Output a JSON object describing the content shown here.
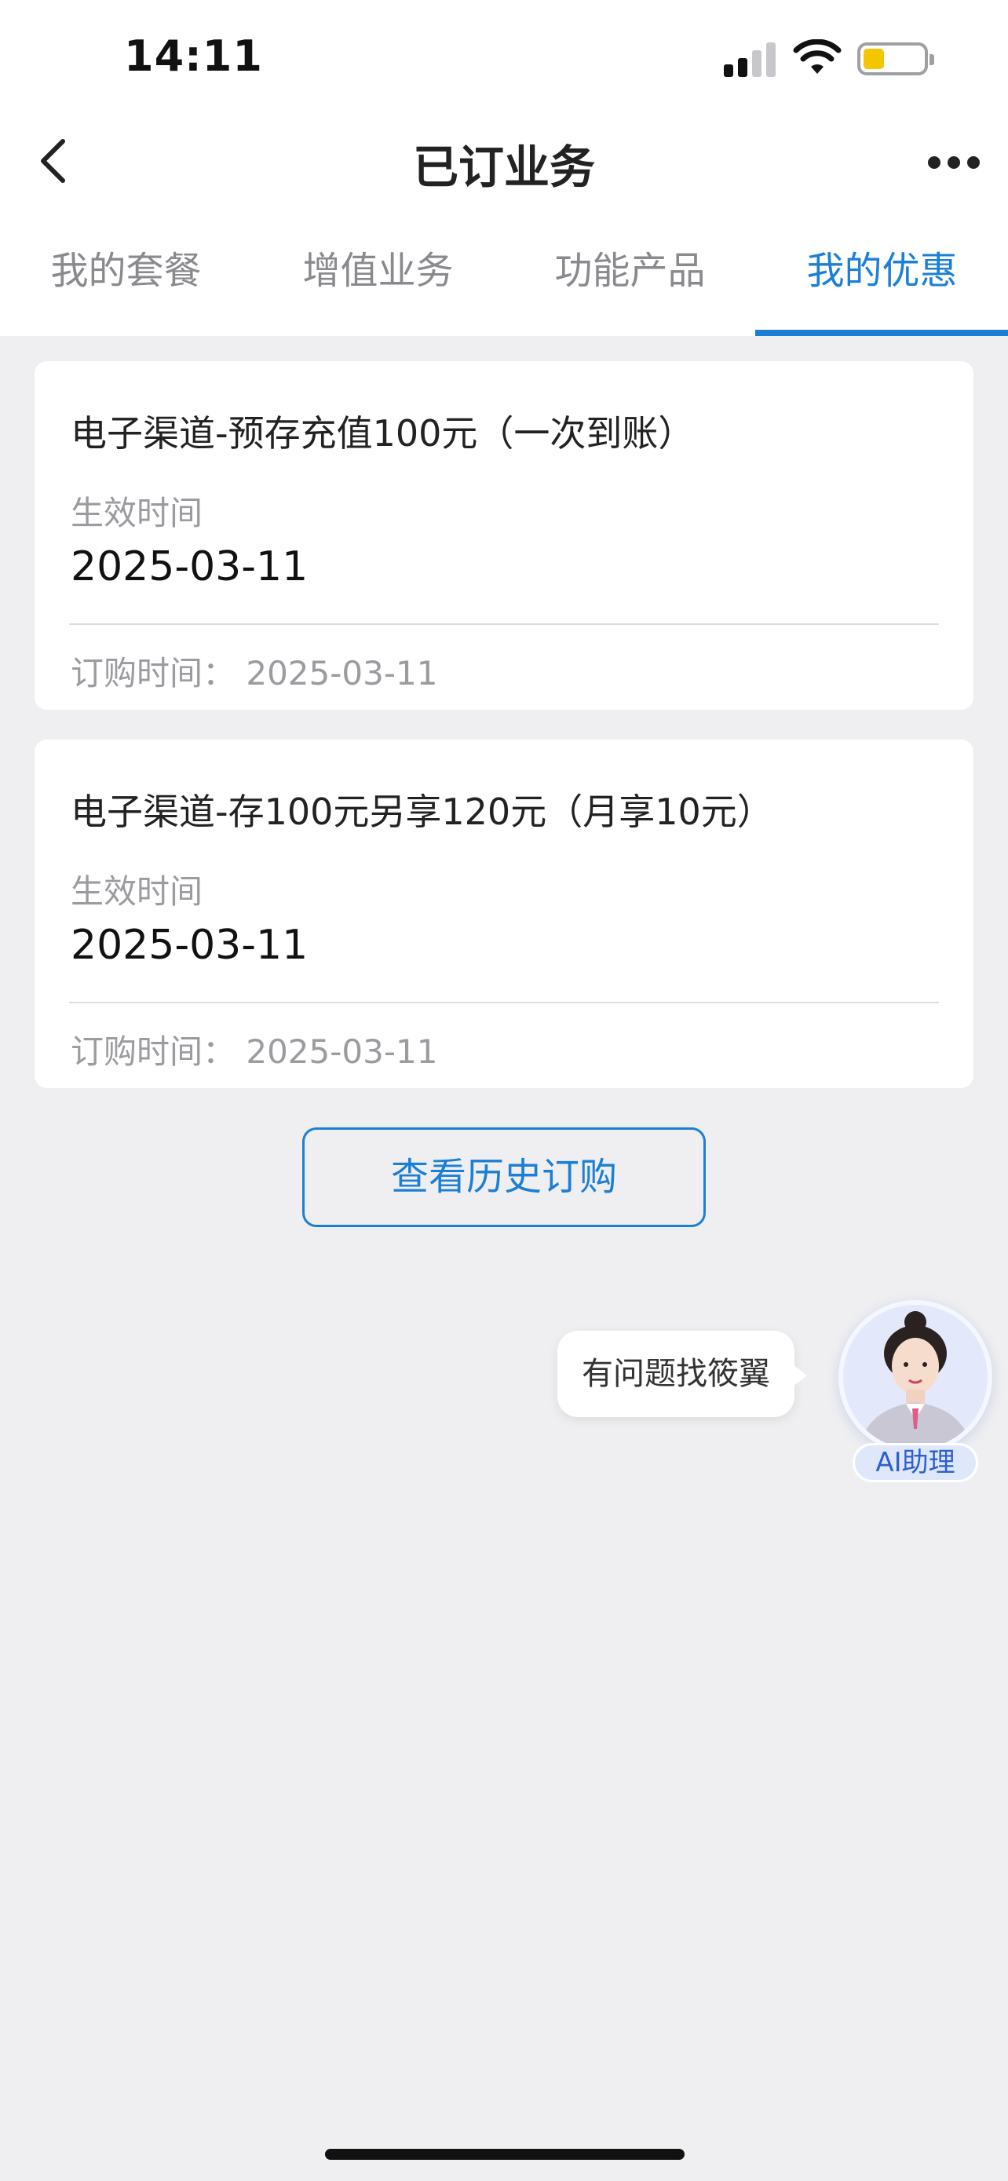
{
  "status_bar": {
    "time": "14:11"
  },
  "nav": {
    "title": "已订业务",
    "back_icon": "chevron-left-icon",
    "more_icon": "more-dots-icon"
  },
  "tabs": [
    {
      "label": "我的套餐",
      "active": false
    },
    {
      "label": "增值业务",
      "active": false
    },
    {
      "label": "功能产品",
      "active": false
    },
    {
      "label": "我的优惠",
      "active": true
    }
  ],
  "cards": [
    {
      "title": "电子渠道-预存充值100元（一次到账）",
      "effective_label": "生效时间",
      "effective_date": "2025-03-11",
      "order_text": "订购时间：  2025-03-11"
    },
    {
      "title": "电子渠道-存100元另享120元（月享10元）",
      "effective_label": "生效时间",
      "effective_date": "2025-03-11",
      "order_text": "订购时间：  2025-03-11"
    }
  ],
  "history_button": "查看历史订购",
  "assistant": {
    "bubble_text": "有问题找筱翼",
    "badge": "AI助理"
  },
  "colors": {
    "accent": "#1c7fd6",
    "background": "#efeff1",
    "muted_text": "#9b9ba0",
    "battery": "#f3c600"
  }
}
